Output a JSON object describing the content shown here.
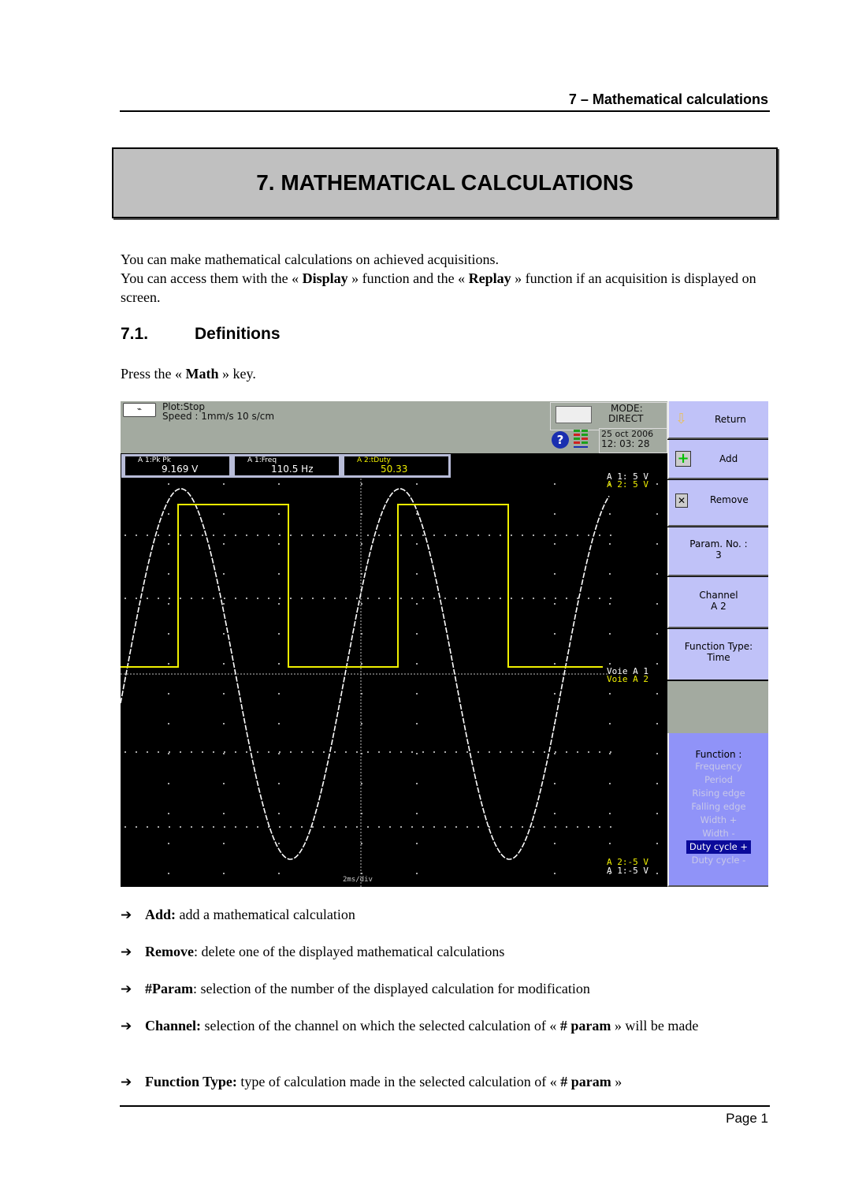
{
  "header": {
    "running_title": "7 – Mathematical calculations"
  },
  "chapter": {
    "title": "7. MATHEMATICAL CALCULATIONS"
  },
  "intro": {
    "line1": "You can make mathematical calculations on achieved acquisitions.",
    "line2_pre": "You can access them with the « ",
    "line2_b1": "Display",
    "line2_mid": " » function and the « ",
    "line2_b2": "Replay",
    "line2_post": " » function if an acquisition is displayed on screen."
  },
  "section": {
    "number": "7.1.",
    "title": "Definitions"
  },
  "press": {
    "pre": "Press the « ",
    "key": "Math",
    "post": " » key."
  },
  "scope": {
    "status": {
      "plot": "Plot:Stop",
      "speed": "Speed : 1mm/s 10 s/cm",
      "plot_icon": "plot-recorder-icon"
    },
    "mode": {
      "label": "MODE:",
      "value": "DIRECT"
    },
    "date": "25 oct 2006",
    "time": "12: 03: 28",
    "help_icon": "?",
    "measurements": [
      {
        "label": "A 1:Pk Pk",
        "value": "9.169 V",
        "color": "#ffffff"
      },
      {
        "label": "A 1:Freq",
        "value": "110.5 Hz",
        "color": "#ffffff"
      },
      {
        "label": "A 2:tDuty",
        "value": "50.33",
        "color": "#f0f000"
      }
    ],
    "scale_top": [
      {
        "text": "A 1: 5 V",
        "color": "#ffffff"
      },
      {
        "text": "A 2: 5 V",
        "color": "#f0f000"
      }
    ],
    "ground_labels": [
      {
        "text": "Voie A 1",
        "color": "#ffffff"
      },
      {
        "text": "Voie A 2",
        "color": "#f0f000"
      }
    ],
    "scale_bottom": [
      {
        "text": "A 2:-5 V",
        "color": "#f0f000"
      },
      {
        "text": "A 1:-5 V",
        "color": "#ffffff"
      }
    ],
    "timebase": "2ms/div",
    "menu": {
      "return": "Return",
      "add": "Add",
      "remove": "Remove",
      "param_label": "Param. No. :",
      "param_value": "3",
      "channel_label": "Channel",
      "channel_value": "A 2",
      "ftype_label": "Function Type:",
      "ftype_value": "Time",
      "function_label": "Function :",
      "functions": [
        "Frequency",
        "Period",
        "Rising edge",
        "Falling edge",
        "Width +",
        "Width -",
        "Duty cycle +",
        "Duty cycle -"
      ],
      "selected_function": "Duty cycle +"
    },
    "colors": {
      "ch1": "#ffffff",
      "ch2": "#f0f000",
      "menu_bg": "#c0c2f8",
      "function_bg": "#9093f8",
      "selected_bg": "#0a0a9a"
    }
  },
  "bullets": [
    {
      "term": "Add:",
      "text": " add a mathematical calculation"
    },
    {
      "term": "Remove",
      "text": ": delete one of the displayed mathematical calculations"
    },
    {
      "term": "#Param",
      "text": ": selection of the number of the displayed calculation for modification"
    },
    {
      "term": "Channel:",
      "text": " selection of the channel on which the selected calculation of « ",
      "term2": "# param",
      "text2": " » will be made"
    },
    {
      "term": "Function Type:",
      "text": " type of calculation made in the selected calculation of « ",
      "term2": "# param",
      "text2": " »"
    }
  ],
  "footer": {
    "page": "Page 1"
  }
}
